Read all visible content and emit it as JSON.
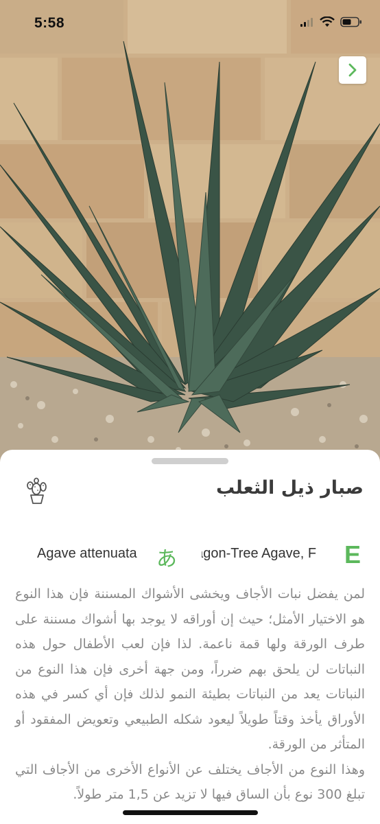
{
  "status_bar": {
    "time": "5:58"
  },
  "plant": {
    "arabic_name": "صبار ذيل الثعلب",
    "latin_name": "Agave attenuata",
    "japanese_badge": "あ",
    "english_name": "Dragon-Tree Agave, F",
    "english_badge": "E",
    "description": [
      "لمن يفضل نبات الأجاف ويخشى الأشواك المسننة فإن هذا النوع هو الاختيار الأمثل؛ حيث إن أوراقه لا يوجد بها أشواك مسننة على طرف الورقة ولها قمة ناعمة. لذا فإن لعب الأطفال حول هذه النباتات لن يلحق بهم ضرراً، ومن جهة أخرى فإن هذا النوع من النباتات يعد من النباتات بطيئة النمو لذلك فإن أي كسر في هذه الأوراق يأخذ وقتاً طويلاً ليعود شكله الطبيعي وتعويض المفقود أو المتأثر من الورقة.",
      "وهذا النوع من الأجاف يختلف عن الأنواع الأخرى من الأجاف التي تبلغ 300 نوع بأن الساق فيها لا تزيد عن 1,5 متر طولاً."
    ]
  },
  "icons": {
    "next": "chevron-right-icon",
    "cactus": "cactus-icon",
    "signal": "signal-icon",
    "wifi": "wifi-icon",
    "battery": "battery-icon"
  },
  "colors": {
    "accent": "#5cb85c",
    "title": "#3b3b3b",
    "body_text": "#8a8a8a"
  }
}
